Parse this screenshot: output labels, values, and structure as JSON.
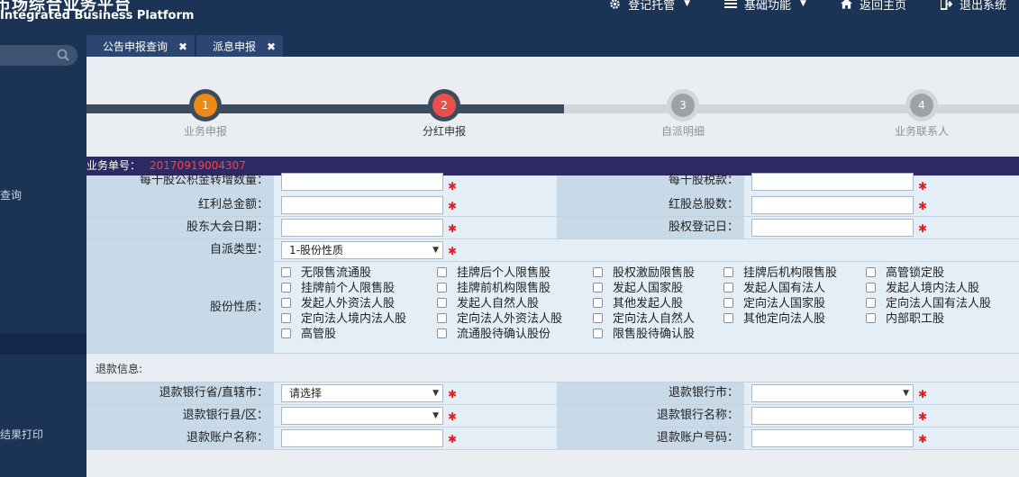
{
  "header": {
    "brand_cn": "市场综合业务平台",
    "brand_en": "Integrated Business Platform",
    "nav": [
      {
        "label": "登记托管",
        "icon": "gear-icon",
        "has_caret": true
      },
      {
        "label": "基础功能",
        "icon": "list-icon",
        "has_caret": true
      },
      {
        "label": "返回主页",
        "icon": "home-icon",
        "has_caret": false
      },
      {
        "label": "退出系统",
        "icon": "logout-icon",
        "has_caret": false
      }
    ]
  },
  "sidebar": {
    "items": [
      "查询",
      "结果打印"
    ]
  },
  "tabs": [
    {
      "label": "公告申报查询",
      "close": "✖"
    },
    {
      "label": "派息申报",
      "close": "✖"
    }
  ],
  "steps": [
    {
      "num": "1",
      "label": "业务申报",
      "color": "#ec8a14"
    },
    {
      "num": "2",
      "label": "分红申报",
      "color": "#e8514b"
    },
    {
      "num": "3",
      "label": "自派明细",
      "color": "#9ea2a7"
    },
    {
      "num": "4",
      "label": "业务联系人",
      "color": "#9ea2a7"
    }
  ],
  "order": {
    "label": "业务单号：",
    "number": "20170919004307"
  },
  "form": {
    "left": {
      "row1": "每十股公积金转增数量：",
      "row2": "红利总金额：",
      "row3": "股东大会日期：",
      "row4": "自派类型：",
      "row5": "股份性质："
    },
    "right": {
      "row1": "每十股税款：",
      "row2": "红股总股数：",
      "row3": "股权登记日："
    },
    "dispatch_type_value": "1-股份性质",
    "star": "✱",
    "share_types": [
      "无限售流通股",
      "挂牌后个人限售股",
      "股权激励限售股",
      "挂牌后机构限售股",
      "高管锁定股",
      "挂牌前个人限售股",
      "挂牌前机构限售股",
      "发起人国家股",
      "发起人国有法人",
      "发起人境内法人股",
      "发起人外资法人股",
      "发起人自然人股",
      "其他发起人股",
      "定向法人国家股",
      "定向法人国有法人股",
      "定向法人境内法人股",
      "定向法人外资法人股",
      "定向法人自然人",
      "其他定向法人股",
      "内部职工股",
      "高管股",
      "流通股待确认股份",
      "限售股待确认股"
    ],
    "refund_title": "退款信息:",
    "refund_left": [
      "退款银行省/直辖市：",
      "退款银行县/区：",
      "退款账户名称："
    ],
    "refund_right": [
      "退款银行市：",
      "退款银行名称：",
      "退款账户号码："
    ],
    "province_placeholder": "请选择"
  },
  "colors": {
    "nav_bg": "#1b3354",
    "label_bg": "#c8d9e8",
    "order_bar": "#2d2a63",
    "required": "#e02020"
  }
}
